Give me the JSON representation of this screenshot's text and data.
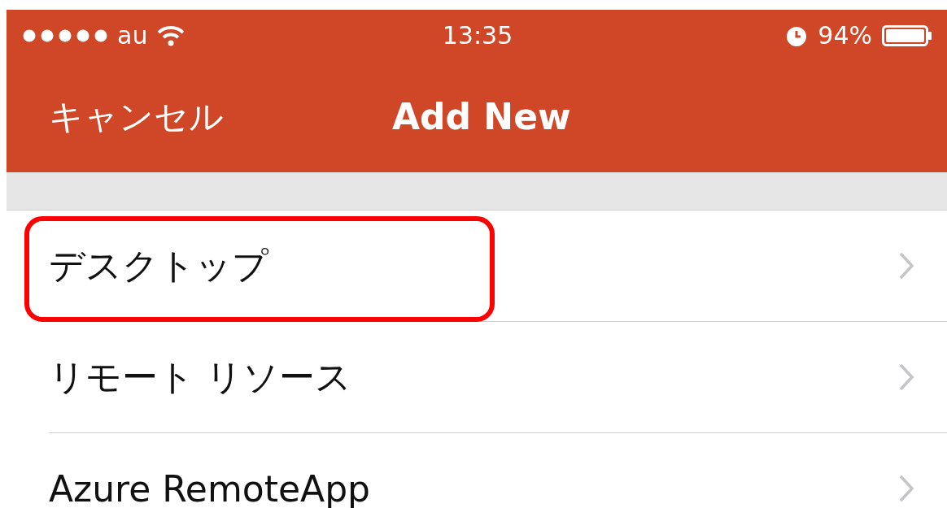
{
  "status_bar": {
    "carrier": "au",
    "time": "13:35",
    "battery": "94%"
  },
  "nav": {
    "cancel": "キャンセル",
    "title": "Add New"
  },
  "rows": [
    {
      "label": "デスクトップ",
      "highlighted": true
    },
    {
      "label": "リモート リソース",
      "highlighted": false
    },
    {
      "label": "Azure RemoteApp",
      "highlighted": false
    }
  ]
}
